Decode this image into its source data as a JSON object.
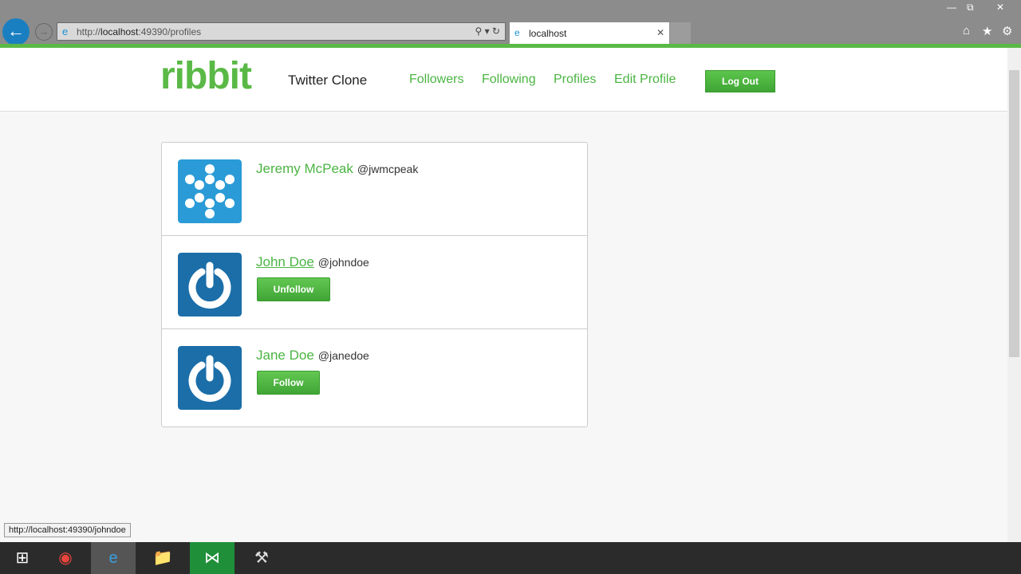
{
  "browser": {
    "url_prefix": "http://",
    "url_host": "localhost",
    "url_rest": ":49390/profiles",
    "tab_title": "localhost",
    "status_url": "http://localhost:49390/johndoe"
  },
  "site": {
    "logo": "ribbit",
    "tagline": "Twitter Clone",
    "nav": [
      "Followers",
      "Following",
      "Profiles",
      "Edit Profile"
    ],
    "logout": "Log Out"
  },
  "profiles": [
    {
      "name": "Jeremy McPeak",
      "handle": "@jwmcpeak",
      "avatar": "dots-icon",
      "button": null
    },
    {
      "name": "John Doe",
      "handle": "@johndoe",
      "avatar": "power-icon",
      "button": "Unfollow"
    },
    {
      "name": "Jane Doe",
      "handle": "@janedoe",
      "avatar": "power-icon",
      "button": "Follow"
    }
  ],
  "colors": {
    "brand": "#5ab946",
    "avatar_blue": "#2a9bd6",
    "avatar_dark": "#1b6ea8"
  }
}
